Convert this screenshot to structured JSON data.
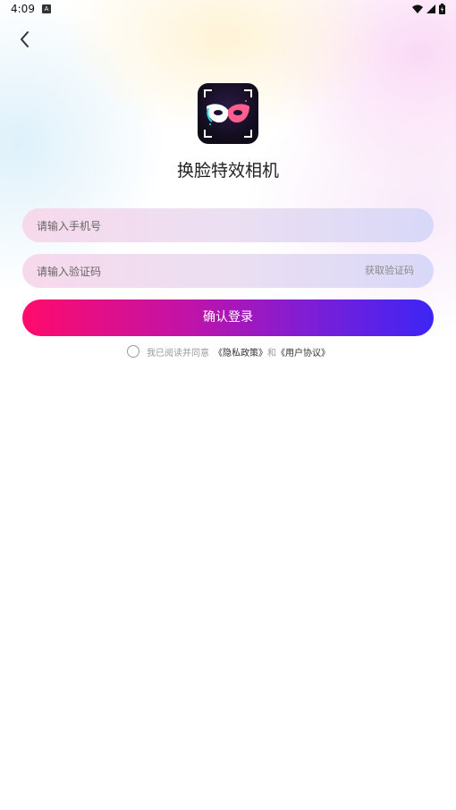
{
  "status_bar": {
    "time": "4:09",
    "badge": "A"
  },
  "app": {
    "name": "换脸特效相机"
  },
  "form": {
    "phone_placeholder": "请输入手机号",
    "code_placeholder": "请输入验证码",
    "get_code_label": "获取验证码",
    "login_label": "确认登录"
  },
  "agreement": {
    "prefix": "我已阅读并同意",
    "privacy_link": "《隐私政策》",
    "and": "和",
    "user_link": "《用户协议》",
    "checked": false
  },
  "colors": {
    "login_gradient_start": "#ff0b6b",
    "login_gradient_end": "#3d25f5"
  }
}
